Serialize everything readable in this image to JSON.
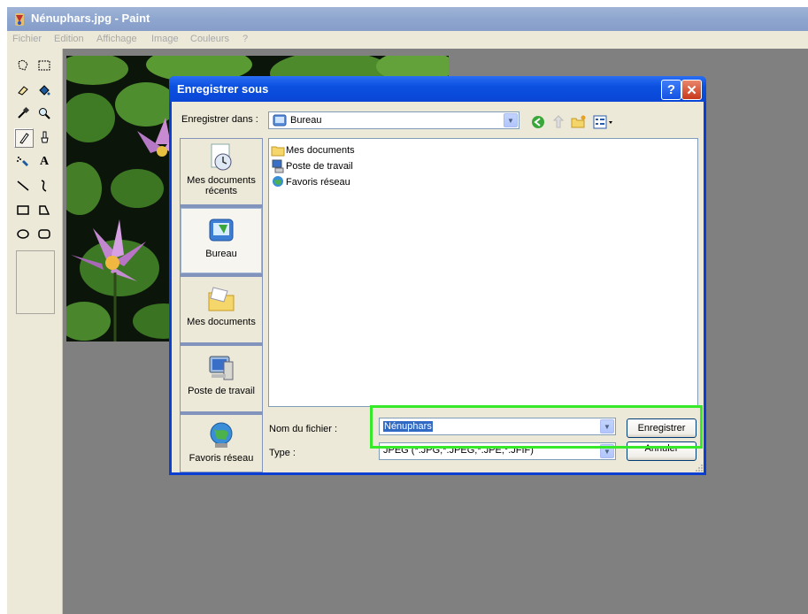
{
  "window": {
    "title": "Nénuphars.jpg - Paint"
  },
  "menu": [
    "Fichier",
    "Edition",
    "Affichage",
    "Image",
    "Couleurs",
    "?"
  ],
  "tools": [
    {
      "name": "free-select-icon"
    },
    {
      "name": "rect-select-icon"
    },
    {
      "name": "eraser-icon"
    },
    {
      "name": "fill-icon"
    },
    {
      "name": "color-picker-icon"
    },
    {
      "name": "magnifier-icon"
    },
    {
      "name": "pencil-icon"
    },
    {
      "name": "brush-icon"
    },
    {
      "name": "airbrush-icon"
    },
    {
      "name": "text-icon"
    },
    {
      "name": "line-icon"
    },
    {
      "name": "curve-icon"
    },
    {
      "name": "rectangle-icon"
    },
    {
      "name": "polygon-icon"
    },
    {
      "name": "ellipse-icon"
    },
    {
      "name": "rounded-rect-icon"
    }
  ],
  "dialog": {
    "title": "Enregistrer sous",
    "help_button": "?",
    "close_button": "✕",
    "save_in_label": "Enregistrer dans :",
    "save_in_value": "Bureau",
    "places": [
      {
        "label": "Mes documents récents",
        "icon": "recent-documents-icon"
      },
      {
        "label": "Bureau",
        "icon": "desktop-icon"
      },
      {
        "label": "Mes documents",
        "icon": "my-documents-icon"
      },
      {
        "label": "Poste de travail",
        "icon": "my-computer-icon"
      },
      {
        "label": "Favoris réseau",
        "icon": "network-places-icon"
      }
    ],
    "files": [
      {
        "label": "Mes documents",
        "icon": "folder-icon"
      },
      {
        "label": "Poste de travail",
        "icon": "computer-icon"
      },
      {
        "label": "Favoris réseau",
        "icon": "network-icon"
      }
    ],
    "filename_label": "Nom du fichier :",
    "filename_value": "Nénuphars",
    "type_label": "Type :",
    "type_value": "JPEG (*.JPG;*.JPEG;*.JPE;*.JFIF)",
    "save_button": "Enregistrer",
    "cancel_button": "Annuler"
  },
  "colors": {
    "highlight": "#36ea2a",
    "dialog_title": "#0a50e0"
  }
}
